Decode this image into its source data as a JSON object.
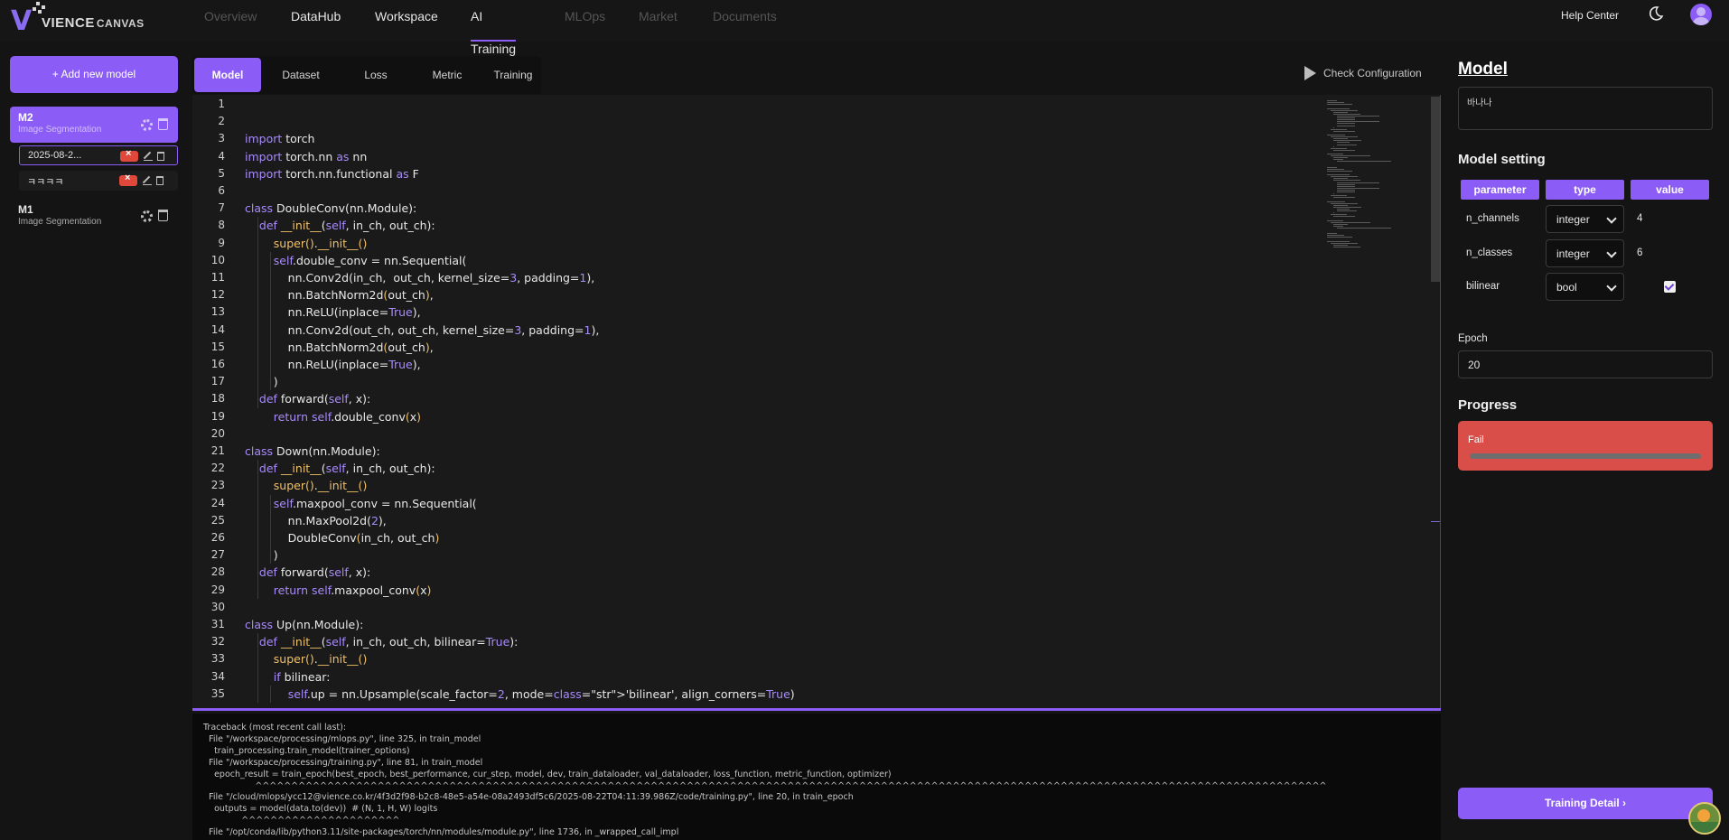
{
  "logo": {
    "brand": "VIENCE",
    "product": "CANVAS"
  },
  "nav": [
    {
      "label": "Overview",
      "state": "disabled"
    },
    {
      "label": "DataHub",
      "state": "enabled"
    },
    {
      "label": "Workspace",
      "state": "enabled"
    },
    {
      "label": "AI Training",
      "state": "active"
    },
    {
      "label": "MLOps",
      "state": "disabled"
    },
    {
      "label": "Market",
      "state": "disabled"
    },
    {
      "label": "Documents",
      "state": "disabled"
    }
  ],
  "header": {
    "help": "Help Center"
  },
  "sidebar": {
    "add_label": "+  Add new model",
    "models": [
      {
        "name": "M2",
        "type": "Image Segmentation",
        "active": true,
        "versions": [
          {
            "label": "2025-08-2...",
            "selected": true
          },
          {
            "label": "ㅋㅋㅋㅋ",
            "selected": false
          }
        ]
      },
      {
        "name": "M1",
        "type": "Image Segmentation",
        "active": false,
        "versions": []
      }
    ]
  },
  "tabs": [
    "Model",
    "Dataset",
    "Loss",
    "Metric",
    "Training"
  ],
  "active_tab": "Model",
  "check_config": "Check Configuration",
  "code_lines": [
    "",
    "",
    "import torch",
    "import torch.nn as nn",
    "import torch.nn.functional as F",
    "",
    "class DoubleConv(nn.Module):",
    "    def __init__(self, in_ch, out_ch):",
    "        super().__init__()",
    "        self.double_conv = nn.Sequential(",
    "            nn.Conv2d(in_ch,  out_ch, kernel_size=3, padding=1),",
    "            nn.BatchNorm2d(out_ch),",
    "            nn.ReLU(inplace=True),",
    "            nn.Conv2d(out_ch, out_ch, kernel_size=3, padding=1),",
    "            nn.BatchNorm2d(out_ch),",
    "            nn.ReLU(inplace=True),",
    "        )",
    "    def forward(self, x):",
    "        return self.double_conv(x)",
    "",
    "class Down(nn.Module):",
    "    def __init__(self, in_ch, out_ch):",
    "        super().__init__()",
    "        self.maxpool_conv = nn.Sequential(",
    "            nn.MaxPool2d(2),",
    "            DoubleConv(in_ch, out_ch)",
    "        )",
    "    def forward(self, x):",
    "        return self.maxpool_conv(x)",
    "",
    "class Up(nn.Module):",
    "    def __init__(self, in_ch, out_ch, bilinear=True):",
    "        super().__init__()",
    "        if bilinear:",
    "            self.up = nn.Upsample(scale_factor=2, mode='bilinear', align_corners=True)"
  ],
  "console": [
    "Traceback (most recent call last):",
    "  File \"/workspace/processing/mlops.py\", line 325, in train_model",
    "    train_processing.train_model(trainer_options)",
    "  File \"/workspace/processing/training.py\", line 81, in train_model",
    "    epoch_result = train_epoch(best_epoch, best_performance, cur_step, model, dev, train_dataloader, val_dataloader, loss_function, metric_function, optimizer)",
    "                   ^^^^^^^^^^^^^^^^^^^^^^^^^^^^^^^^^^^^^^^^^^^^^^^^^^^^^^^^^^^^^^^^^^^^^^^^^^^^^^^^^^^^^^^^^^^^^^^^^^^^^^^^^^^^^^^^^^^^^^^^^^^^^^^^^^^^^^^^^^^^^^^^^^^^^",
    "  File \"/cloud/mlops/ycc12@vience.co.kr/4f3d2f98-b2c8-48e5-a54e-08a2493df5c6/2025-08-22T04:11:39.986Z/code/training.py\", line 20, in train_epoch",
    "    outputs = model(data.to(dev))  # (N, 1, H, W) logits",
    "              ^^^^^^^^^^^^^^^^^^^^^^",
    "  File \"/opt/conda/lib/python3.11/site-packages/torch/nn/modules/module.py\", line 1736, in _wrapped_call_impl"
  ],
  "right_panel": {
    "title": "Model",
    "description": "바나나",
    "model_setting_title": "Model setting",
    "headers": [
      "parameter",
      "type",
      "value"
    ],
    "params": [
      {
        "name": "n_channels",
        "type": "integer",
        "value": "4"
      },
      {
        "name": "n_classes",
        "type": "integer",
        "value": "6"
      },
      {
        "name": "bilinear",
        "type": "bool",
        "value": true
      }
    ],
    "epoch_label": "Epoch",
    "epoch_value": "20",
    "progress_title": "Progress",
    "progress_status": "Fail",
    "progress_fraction": 0.0,
    "detail_button": "Training Detail  ›"
  },
  "colors": {
    "accent": "#8b5cf6",
    "fail": "#d94e48"
  },
  "icons": [
    "moon-icon",
    "user-avatar-icon",
    "gear-icon",
    "trash-icon",
    "close-badge-icon",
    "edit-icon",
    "play-icon",
    "chevron-down-icon",
    "checkbox-icon",
    "assistant-fab-icon"
  ]
}
